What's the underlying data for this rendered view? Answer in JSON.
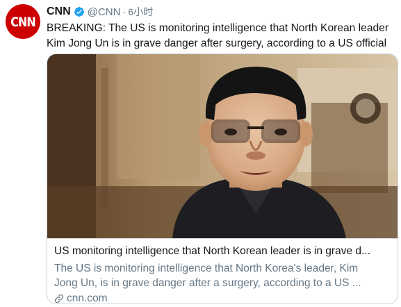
{
  "author": {
    "display_name": "CNN",
    "handle": "@CNN",
    "separator": "·",
    "time": "6小时",
    "avatar_text": "CNN",
    "verified": true
  },
  "tweet": {
    "text_lines": [
      "BREAKING: The US is monitoring intelligence that North Korean leader",
      "Kim Jong Un is in grave danger after surgery, according to a US official"
    ]
  },
  "card": {
    "title": "US monitoring intelligence that North Korean leader is in grave d...",
    "description_lines": [
      "The US is monitoring intelligence that North Korea's leader, Kim",
      "Jong Un, is in grave danger after a surgery, according to a US ..."
    ],
    "domain": "cnn.com"
  },
  "colors": {
    "cnn_red": "#cc0000",
    "verified_blue": "#1da1f2",
    "secondary_text": "#657786",
    "border": "#ccd6dd"
  },
  "icons": {
    "verified": "verified-badge-icon",
    "link": "link-icon"
  }
}
